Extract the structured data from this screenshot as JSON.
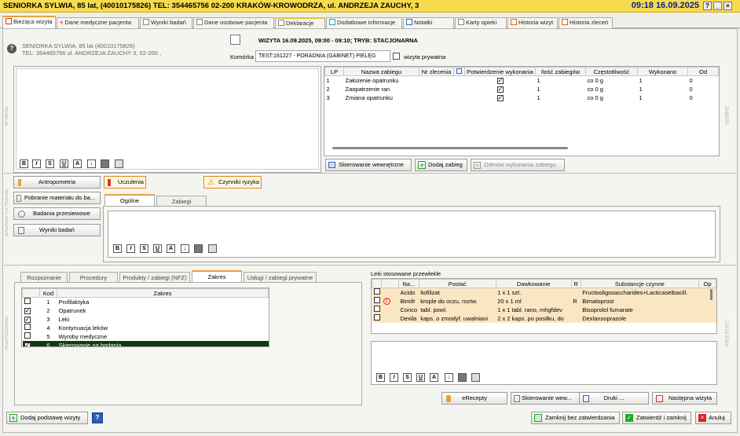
{
  "titlebar": {
    "title": "SENIORKA SYLWIA, 85 lat, (40010175826) TEL: 354465756 02-200 KRAKÓW-KROWODRZA, ul. ANDRZEJA ZAUCHY, 3",
    "clock": "09:18 16.09.2025"
  },
  "tabs": [
    {
      "label": "Bieżąca wizyta"
    },
    {
      "label": "Dane medyczne pacjenta"
    },
    {
      "label": "Wyniki badań"
    },
    {
      "label": "Dane osobowe pacjenta"
    },
    {
      "label": "Deklaracje"
    },
    {
      "label": "Dodatkowe informacje"
    },
    {
      "label": "Notatki"
    },
    {
      "label": "Karty opieki"
    },
    {
      "label": "Historia wizyt"
    },
    {
      "label": "Historia zleceń"
    }
  ],
  "patient": {
    "line1": "SENIORKA SYLWIA, 85 lat (40010175826)",
    "line2": "TEL: 354465756 ul. ANDRZEJA ZAUCHY 3, 02-200 ,"
  },
  "visit": {
    "header": "WIZYTA 16.09.2025, 09:00 - 09:10; TRYB: STACJONARNA",
    "komorka_label": "Komórka",
    "komorka_value": "TEST:161227 - PORADNIA (GABINET) PIELĘG",
    "private_label": "wizyta prywatna"
  },
  "side_labels": {
    "wywiad": "WYWIAD",
    "badanie": "BADANIE FIZYKALNE",
    "rozpoznanie": "ROZPOZNANIE",
    "zabiegi": "ZABIEGI",
    "zalecenia": "ZALECENIA"
  },
  "format_buttons": [
    "B",
    "I",
    "S",
    "U",
    "A"
  ],
  "procedures": {
    "headers": [
      "LP",
      "Nazwa zabiegu",
      "Nr zlecenia",
      "",
      "Potwierdzenie wykonania",
      "Ilość zabiegów",
      "Częstotliwość",
      "Wykonano",
      "Od"
    ],
    "rows": [
      {
        "lp": "1",
        "name": "Założenie opatrunku",
        "qty": "1",
        "freq": "co 0 g",
        "done": "1",
        "od": "0"
      },
      {
        "lp": "2",
        "name": "Zaopatrzenie ran",
        "qty": "1",
        "freq": "co 0 g",
        "done": "1",
        "od": "0"
      },
      {
        "lp": "3",
        "name": "Zmiana opatrunku",
        "qty": "1",
        "freq": "co 0 g",
        "done": "1",
        "od": "0"
      }
    ],
    "buttons": {
      "referral": "Skierowanie wewnętrzne",
      "add": "Dodaj zabieg",
      "refuse": "Odmów wykonania zabiegu"
    }
  },
  "exam": {
    "buttons": {
      "antropometria": "Antropometria",
      "uczulenia": "Uczulenia",
      "ryzyko": "Czynniki ryzyka",
      "pobranie": "Pobranie materiału do ba...",
      "przesiewowe": "Badania przesiewowe",
      "wyniki": "Wyniki badań"
    },
    "tabs": [
      "Ogólne",
      "Zabiegi"
    ]
  },
  "diagnosis": {
    "tabs": [
      "Rozpoznanie",
      "Procedury",
      "Produkty / zabiegi (NFZ)",
      "Zakres",
      "Usługi / zabiegi prywatne"
    ],
    "headers": [
      "Kod",
      "Zakres"
    ],
    "rows": [
      {
        "code": "1",
        "name": "Profilaktyka",
        "checked": false,
        "selected": false
      },
      {
        "code": "2",
        "name": "Opatrunek",
        "checked": true,
        "selected": false
      },
      {
        "code": "3",
        "name": "Leki",
        "checked": true,
        "selected": false
      },
      {
        "code": "4",
        "name": "Kontynuacja leków",
        "checked": false,
        "selected": false
      },
      {
        "code": "5",
        "name": "Wyroby medyczne",
        "checked": false,
        "selected": false
      },
      {
        "code": "6",
        "name": "Skierowanie na badania",
        "checked": true,
        "selected": true
      }
    ]
  },
  "meds": {
    "title": "Leki stosowane przewlekle",
    "headers": [
      "",
      "Na...",
      "Postać",
      "Dawkowanie",
      "R",
      "Substancje czynne",
      "Op"
    ],
    "rows": [
      {
        "warn": false,
        "name": "Acido",
        "form": "liofilizat",
        "dose": "1 x 1 szt.",
        "r": "",
        "subst": "Fructooligosaccharides+Lacticaseibacill."
      },
      {
        "warn": true,
        "name": "Bimifr",
        "form": "krople do oczu, roztw.",
        "dose": "20 x 1 ml",
        "r": "R",
        "subst": "Bimatoprost"
      },
      {
        "warn": false,
        "name": "Conco",
        "form": "tabl. powl.",
        "dose": "1 x 1 tabl. rano, mhgfdev",
        "r": "",
        "subst": "Bisoprolol fumarate"
      },
      {
        "warn": false,
        "name": "Dexila",
        "form": "kaps. o zmodyf. uwalniani",
        "dose": "2 x 2 kaps. po posiłku, do",
        "r": "",
        "subst": "Dexlansoprazole"
      }
    ],
    "buttons": {
      "erecepty": "eRecepty",
      "skierowanie": "Skierowanie wew...",
      "druki": "Druki ...",
      "nastepna": "Następna wizyta"
    }
  },
  "footer": {
    "add_basis": "Dodaj podstawę wizyty",
    "help": "?",
    "close_no_confirm": "Zamknij bez zatwierdzania",
    "confirm_close": "Zatwierdź i zamknij",
    "cancel": "Anuluj"
  },
  "colors": {
    "titlebar": "#f6db4e",
    "clock": "#0a1f8f",
    "accent": "#e8a13a",
    "selected_row": "#0f3d0f",
    "meds_bg": "#fbe6c3"
  }
}
